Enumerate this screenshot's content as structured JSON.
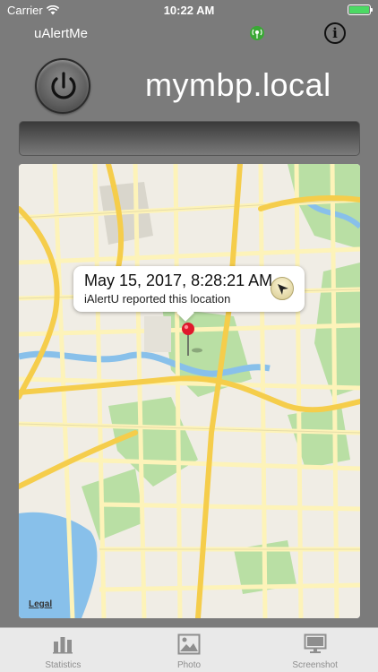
{
  "status_bar": {
    "carrier": "Carrier",
    "time": "10:22 AM",
    "battery_level": 1.0
  },
  "header": {
    "app_title": "uAlertMe",
    "signal_icon": "signal-broadcast-icon",
    "info_icon": "info-icon",
    "info_glyph": "i"
  },
  "device": {
    "power_icon": "power-icon",
    "host_name": "mymbp.local"
  },
  "map": {
    "callout_title": "May 15, 2017, 8:28:21 AM",
    "callout_subtitle": "iAlertU reported this location",
    "directions_icon": "location-arrow-icon",
    "pin_icon": "map-pin-icon",
    "legal_label": "Legal",
    "colors": {
      "water": "#88c0ea",
      "park": "#b9dfa4",
      "road_major": "#f5cd4b",
      "road_minor": "#fdf3b9",
      "land": "#f0ede5"
    }
  },
  "tabs": [
    {
      "label": "Statistics",
      "icon": "bar-chart-icon"
    },
    {
      "label": "Photo",
      "icon": "photo-icon"
    },
    {
      "label": "Screenshot",
      "icon": "monitor-icon"
    }
  ]
}
